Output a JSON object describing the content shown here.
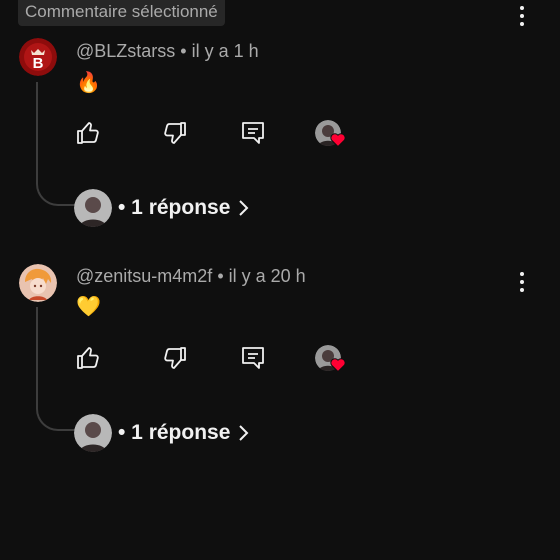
{
  "selected_badge": "Commentaire sélectionné",
  "comments": [
    {
      "author": "@BLZstarss",
      "time": " • il y a 1 h",
      "text": "🔥",
      "replies": "• 1 réponse"
    },
    {
      "author": "@zenitsu-m4m2f",
      "time": " • il y a 20 h",
      "text": "💛",
      "replies": "• 1 réponse"
    }
  ],
  "icons": {
    "like": "thumbs-up-icon",
    "dislike": "thumbs-down-icon",
    "reply": "reply-icon",
    "creator_heart": "creator-heart-icon",
    "menu": "more-vert-icon"
  },
  "colors": {
    "background": "#0f0f0f",
    "heart": "#ff0033",
    "text_secondary": "#aaaaaa",
    "text_primary": "#f1f1f1"
  }
}
